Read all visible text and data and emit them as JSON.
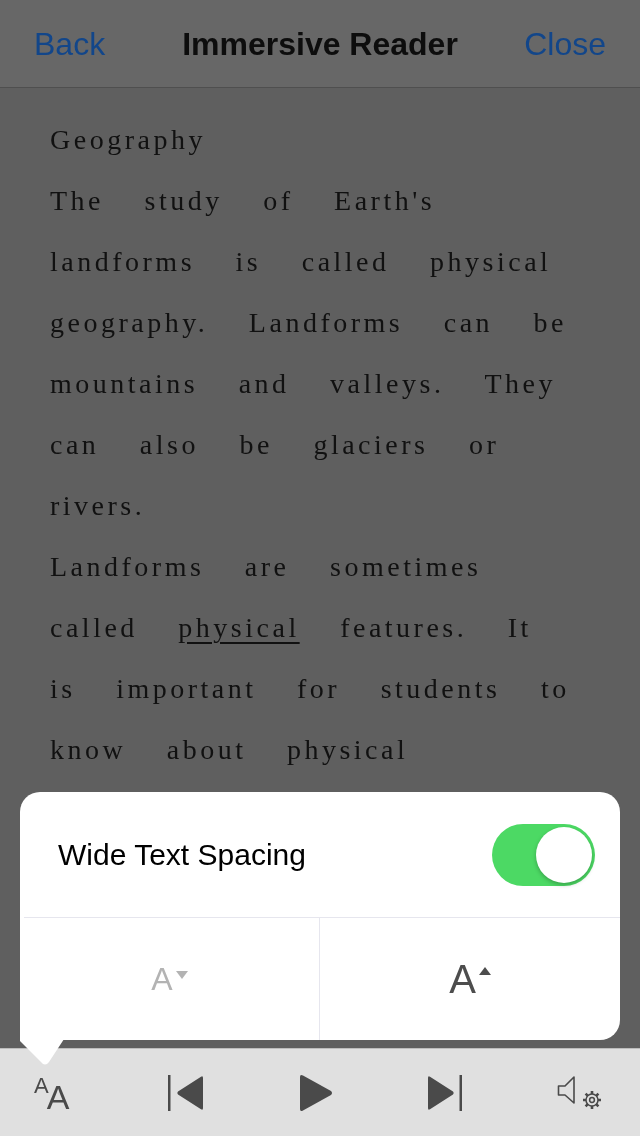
{
  "nav_bar": {
    "back": "Back",
    "title": "Immersive Reader",
    "close": "Close"
  },
  "reader": {
    "heading": "Geography",
    "paragraphs": [
      [
        {
          "kind": "plain",
          "text": "The study of Earth's landforms is called physical geography. Landforms can be mountains and valleys. They can also be glaciers or rivers."
        }
      ],
      [
        {
          "kind": "plain",
          "text": "Landforms are sometimes called "
        },
        {
          "kind": "underlined",
          "text": "physical"
        },
        {
          "kind": "plain",
          "text": " features. It is important for students to know about physical"
        }
      ]
    ]
  },
  "text_options_popover": {
    "wide_spacing": {
      "label": "Wide Text Spacing",
      "on": true
    },
    "size_buttons": [
      {
        "kind": "decrease",
        "label": "A",
        "disabled": true
      },
      {
        "kind": "increase",
        "label": "A",
        "disabled": false
      }
    ]
  },
  "toolbar": {
    "text_size": {
      "small_letter": "A",
      "large_letter": "A"
    }
  }
}
